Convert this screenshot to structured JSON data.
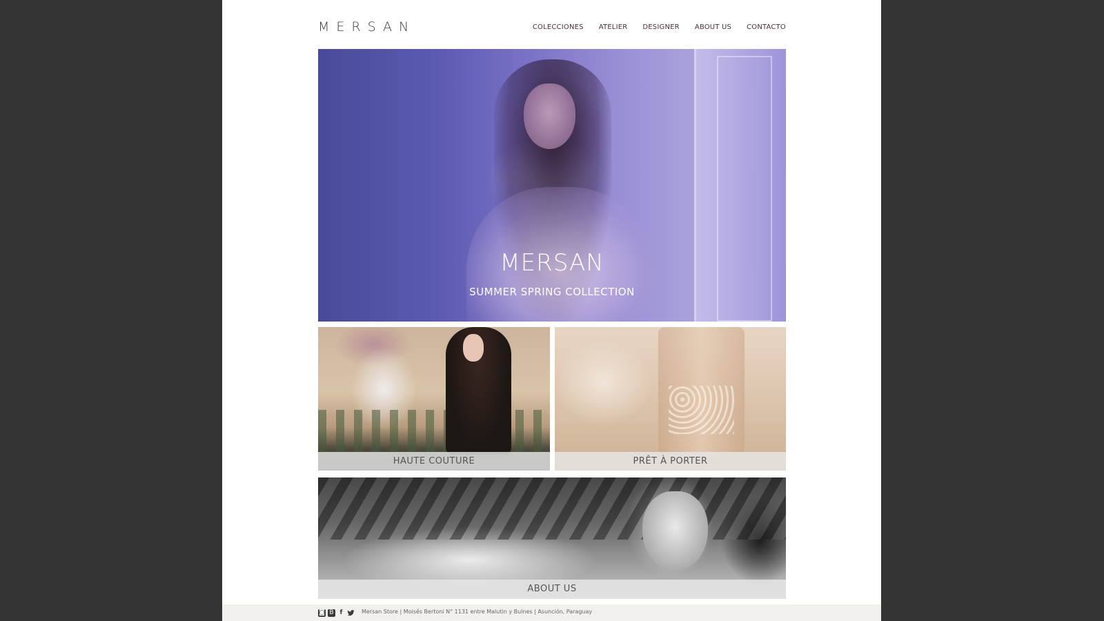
{
  "header": {
    "logo": "MERSAN",
    "nav": [
      {
        "label": "COLECCIONES"
      },
      {
        "label": "ATELIER"
      },
      {
        "label": "DESIGNER"
      },
      {
        "label": "ABOUT US"
      },
      {
        "label": "CONTACTO"
      }
    ]
  },
  "hero": {
    "title": "MERSAN",
    "subtitle": "SUMMER SPRING COLLECTION"
  },
  "tiles": {
    "haute_couture": "HAUTE COUTURE",
    "pret_a_porter": "PRÊT À PORTER",
    "about_us": "ABOUT US"
  },
  "footer": {
    "social": [
      {
        "icon": "instagram-icon",
        "glyph": "◙"
      },
      {
        "icon": "blogger-icon",
        "glyph": "B"
      },
      {
        "icon": "facebook-icon",
        "glyph": "f"
      },
      {
        "icon": "twitter-icon",
        "glyph": "🐦"
      }
    ],
    "address": "Mersan Store | Moisés Bertoni N° 1131 entre Malutin y Bulnes | Asunción, Paraguay"
  },
  "colors": {
    "backdrop": "#333333",
    "page": "#ffffff",
    "nav_text": "#4a2f3d",
    "caption_bg": "#e6e6e6",
    "footer_bg": "#f2f0ec"
  }
}
